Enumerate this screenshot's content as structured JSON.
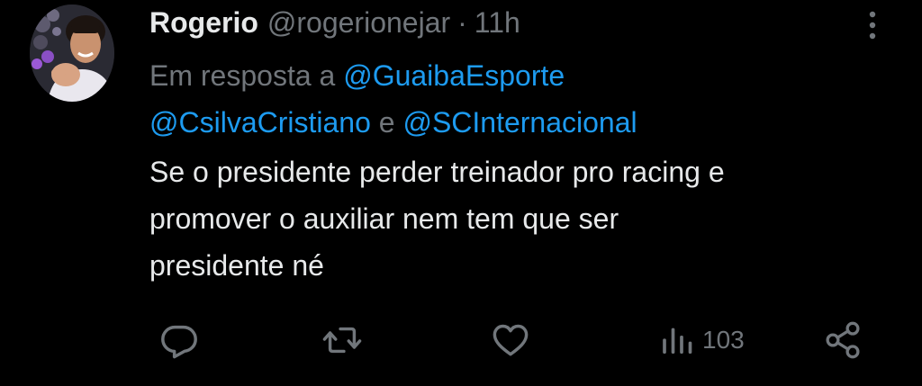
{
  "tweet": {
    "author_name": "Rogerio",
    "handle": "@rogerionejar",
    "separator": "·",
    "time": "11h",
    "reply_prefix": "Em resposta a",
    "mention_1": "@GuaibaEsporte",
    "mention_2": "@CsilvaCristiano",
    "conjunction": "e",
    "mention_3": "@SCInternacional",
    "text_lines": [
      "Se o presidente perder treinador pro racing e",
      "promover o auxiliar nem tem que ser",
      "presidente né"
    ],
    "views": "103"
  },
  "icons": {
    "more": "more-vertical-icon",
    "reply": "reply-icon",
    "retweet": "retweet-icon",
    "like": "heart-icon",
    "views": "views-icon",
    "share": "share-icon"
  },
  "colors": {
    "background": "#000000",
    "text": "#e7e9ea",
    "secondary": "#71767b",
    "link": "#1d9bf0"
  }
}
